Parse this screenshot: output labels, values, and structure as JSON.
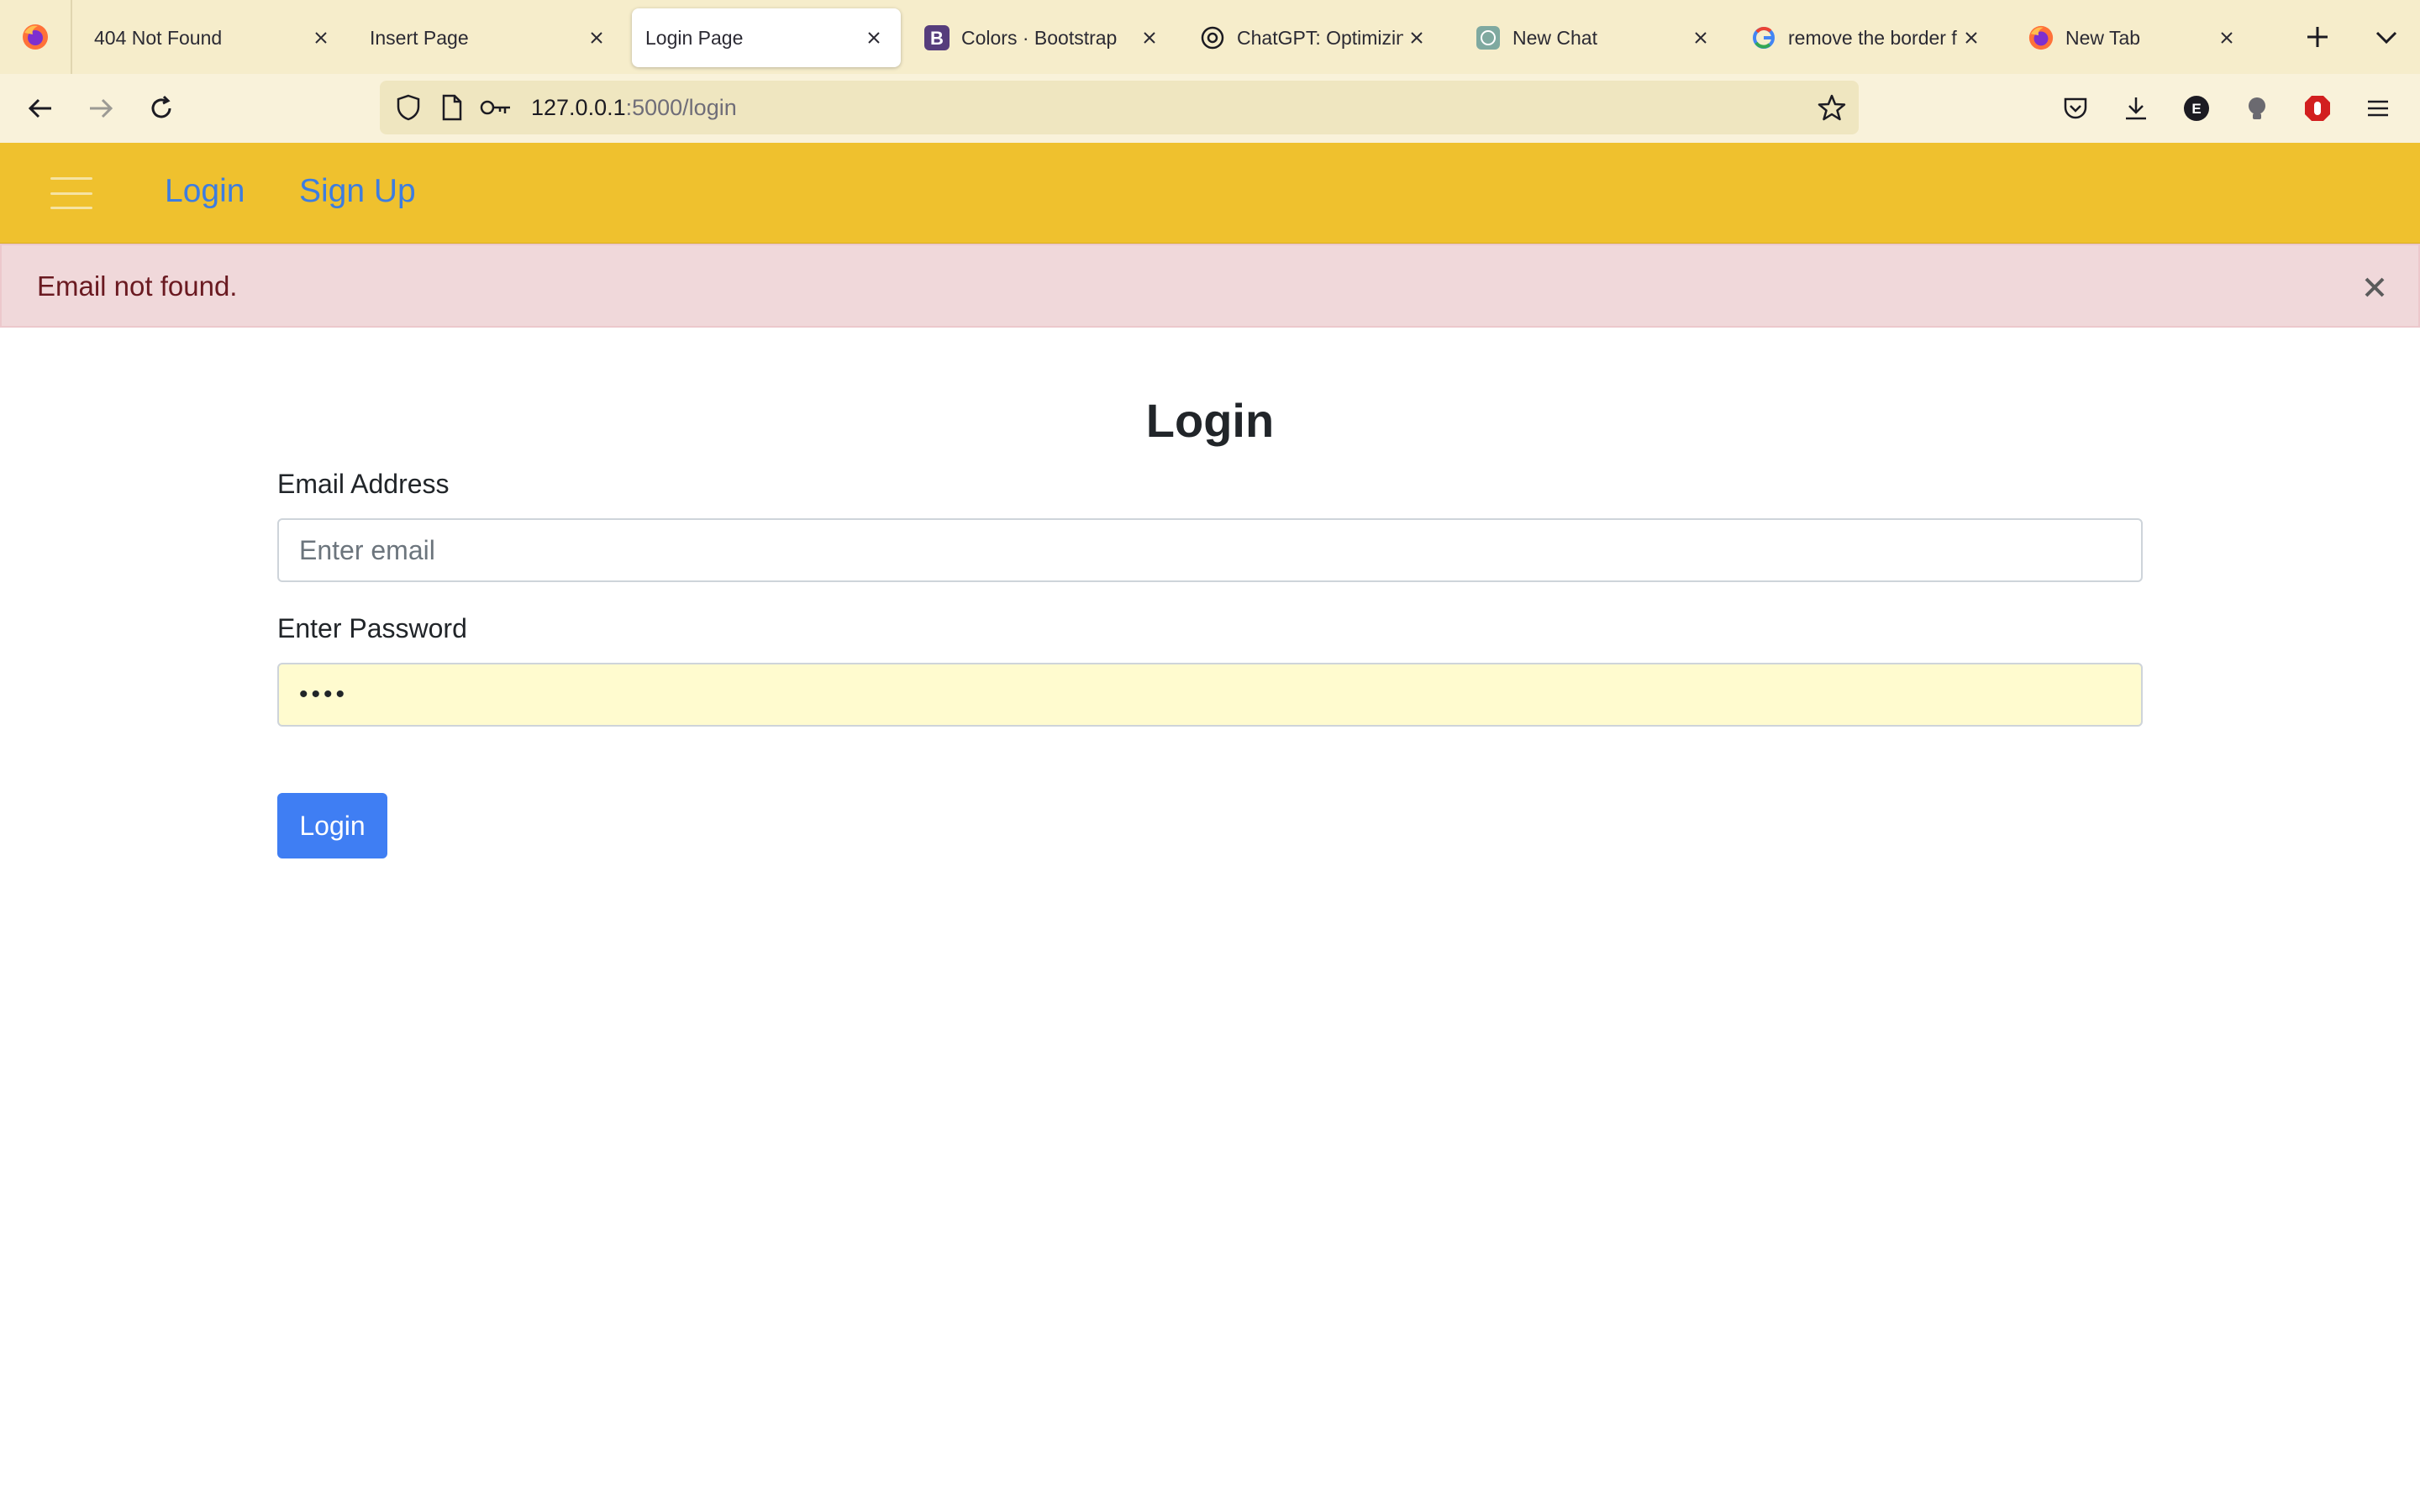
{
  "browser": {
    "tabs": [
      {
        "title": "404 Not Found",
        "favicon": "firefox-icon",
        "active": false
      },
      {
        "title": "Insert Page",
        "favicon": "none",
        "active": false
      },
      {
        "title": "Login Page",
        "favicon": "none",
        "active": true
      },
      {
        "title": "Colors · Bootstrap",
        "favicon": "bootstrap-icon",
        "active": false
      },
      {
        "title": "ChatGPT: Optimizing",
        "favicon": "chatgpt-icon",
        "active": false
      },
      {
        "title": "New Chat",
        "favicon": "chat-icon",
        "active": false
      },
      {
        "title": "remove the border fr",
        "favicon": "google-icon",
        "active": false
      },
      {
        "title": "New Tab",
        "favicon": "firefox-icon",
        "active": false
      }
    ],
    "url_host": "127.0.0.1",
    "url_rest": ":5000/login",
    "toolbar_icons": [
      "back-icon",
      "forward-icon",
      "reload-icon",
      "shield-icon",
      "page-icon",
      "key-icon",
      "star-icon",
      "pocket-icon",
      "download-icon",
      "extension-e-icon",
      "extension-bulb-icon",
      "adblock-icon",
      "menu-icon"
    ]
  },
  "site": {
    "nav": {
      "login": "Login",
      "signup": "Sign Up"
    },
    "alert": {
      "message": "Email not found."
    },
    "form": {
      "title": "Login",
      "email_label": "Email Address",
      "email_placeholder": "Enter email",
      "password_label": "Enter Password",
      "password_value": "••••",
      "submit_label": "Login"
    }
  },
  "colors": {
    "navbar": "#efc12e",
    "link": "#3d7de0",
    "alert_bg": "#f0d8da",
    "alert_text": "#6a1a21",
    "primary_button": "#3f7ef3",
    "autofill_bg": "#fffbcf"
  }
}
